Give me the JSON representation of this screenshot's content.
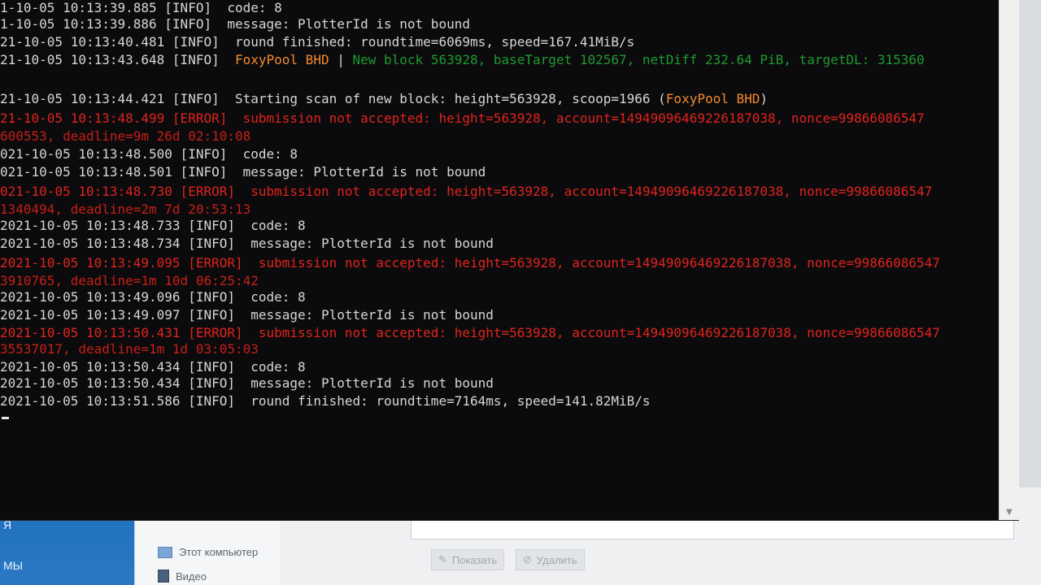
{
  "console": {
    "lines": [
      {
        "segs": [
          {
            "t": "1-10-05 10:13:39.885 [INFO]  code: 8",
            "c": "info"
          }
        ]
      },
      {
        "segs": [
          {
            "t": "1-10-05 10:13:39.886 [INFO]  message: PlotterId is not bound",
            "c": "info"
          }
        ]
      },
      {
        "segs": [
          {
            "t": "21-10-05 10:13:40.481 [INFO]  round finished: roundtime=6069ms, speed=167.41MiB/s",
            "c": "info"
          }
        ]
      },
      {
        "segs": [
          {
            "t": "21-10-05 10:13:43.648 [INFO]  ",
            "c": "info"
          },
          {
            "t": "FoxyPool BHD",
            "c": "pool"
          },
          {
            "t": " | ",
            "c": "info"
          },
          {
            "t": "New block 563928, baseTarget 102567, netDiff 232.64 PiB, targetDL: 315360",
            "c": "grn"
          }
        ]
      },
      {
        "segs": [
          {
            "t": "",
            "c": "info"
          }
        ]
      },
      {
        "segs": [
          {
            "t": "21-10-05 10:13:44.421 [INFO]  Starting scan of new block: height=563928, scoop=1966 (",
            "c": "info"
          },
          {
            "t": "FoxyPool BHD",
            "c": "pool"
          },
          {
            "t": ")",
            "c": "info"
          }
        ]
      },
      {
        "segs": [
          {
            "t": "21-10-05 10:13:48.499 [ERROR]  submission not accepted: height=563928, account=14949096469226187038, nonce=99866086547",
            "c": "err"
          }
        ]
      },
      {
        "segs": [
          {
            "t": "600553, deadline=9m 26d 02:10:08",
            "c": "err-dim"
          }
        ]
      },
      {
        "segs": [
          {
            "t": "021-10-05 10:13:48.500 [INFO]  code: 8",
            "c": "info"
          }
        ]
      },
      {
        "segs": [
          {
            "t": "021-10-05 10:13:48.501 [INFO]  message: PlotterId is not bound",
            "c": "info"
          }
        ]
      },
      {
        "segs": [
          {
            "t": "021-10-05 10:13:48.730 [ERROR]  submission not accepted: height=563928, account=14949096469226187038, nonce=99866086547",
            "c": "err"
          }
        ]
      },
      {
        "segs": [
          {
            "t": "1340494, deadline=2m 7d 20:53:13",
            "c": "err-dim"
          }
        ]
      },
      {
        "segs": [
          {
            "t": "2021-10-05 10:13:48.733 [INFO]  code: 8",
            "c": "info"
          }
        ]
      },
      {
        "segs": [
          {
            "t": "2021-10-05 10:13:48.734 [INFO]  message: PlotterId is not bound",
            "c": "info"
          }
        ]
      },
      {
        "segs": [
          {
            "t": "2021-10-05 10:13:49.095 [ERROR]  submission not accepted: height=563928, account=14949096469226187038, nonce=99866086547",
            "c": "err"
          }
        ]
      },
      {
        "segs": [
          {
            "t": "3910765, deadline=1m 10d 06:25:42",
            "c": "err-dim"
          }
        ]
      },
      {
        "segs": [
          {
            "t": "2021-10-05 10:13:49.096 [INFO]  code: 8",
            "c": "info"
          }
        ]
      },
      {
        "segs": [
          {
            "t": "2021-10-05 10:13:49.097 [INFO]  message: PlotterId is not bound",
            "c": "info"
          }
        ]
      },
      {
        "segs": [
          {
            "t": "2021-10-05 10:13:50.431 [ERROR]  submission not accepted: height=563928, account=14949096469226187038, nonce=99866086547",
            "c": "err"
          }
        ]
      },
      {
        "segs": [
          {
            "t": "35537017, deadline=1m 1d 03:05:03",
            "c": "err-dim"
          }
        ]
      },
      {
        "segs": [
          {
            "t": "2021-10-05 10:13:50.434 [INFO]  code: 8",
            "c": "info"
          }
        ]
      },
      {
        "segs": [
          {
            "t": "2021-10-05 10:13:50.434 [INFO]  message: PlotterId is not bound",
            "c": "info"
          }
        ]
      },
      {
        "segs": [
          {
            "t": "2021-10-05 10:13:51.586 [INFO]  round finished: roundtime=7164ms, speed=141.82MiB/s",
            "c": "info"
          }
        ]
      }
    ]
  },
  "desktop": {
    "left_fragment_1": "Я",
    "left_fragment_2": "МЫ",
    "explorer_items": [
      {
        "label": "Этот компьютер",
        "icon": "computer-icon"
      },
      {
        "label": "Видео",
        "icon": "video-folder-icon"
      }
    ],
    "show_button": "Показать",
    "delete_button": "Удалить"
  },
  "colors": {
    "console_bg": "#0b0b0d",
    "info": "#d6d6d6",
    "error": "#e0231c",
    "pool": "#f28a2e",
    "green": "#1f9a2e"
  }
}
